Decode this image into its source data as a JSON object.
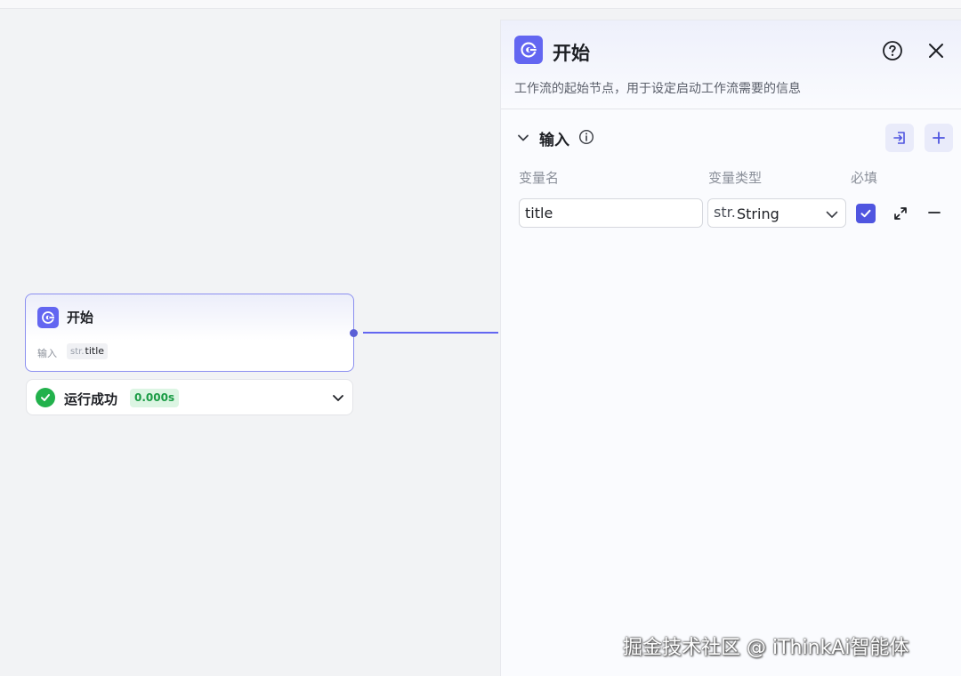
{
  "node": {
    "title": "开始",
    "input_label": "输入",
    "input_type": "str.",
    "input_name": "title"
  },
  "run_status": {
    "text": "运行成功",
    "duration": "0.000s"
  },
  "panel": {
    "title": "开始",
    "description": "工作流的起始节点，用于设定启动工作流需要的信息",
    "section_title": "输入",
    "columns": {
      "name": "变量名",
      "type": "变量类型",
      "required": "必填"
    },
    "variables": [
      {
        "name": "title",
        "type_prefix": "str.",
        "type": "String",
        "required": true
      }
    ]
  },
  "colors": {
    "accent": "#6366f1",
    "success": "#22b14c",
    "success_bg": "#dcf5e3"
  },
  "icons": [
    "start-node-icon",
    "check-circle-icon",
    "chevron-down-icon",
    "help-icon",
    "close-icon",
    "info-icon",
    "import-icon",
    "plus-icon",
    "expand-icon",
    "minus-icon",
    "checkbox-checked-icon"
  ],
  "watermark": "掘金技术社区 @ iThinkAi智能体"
}
